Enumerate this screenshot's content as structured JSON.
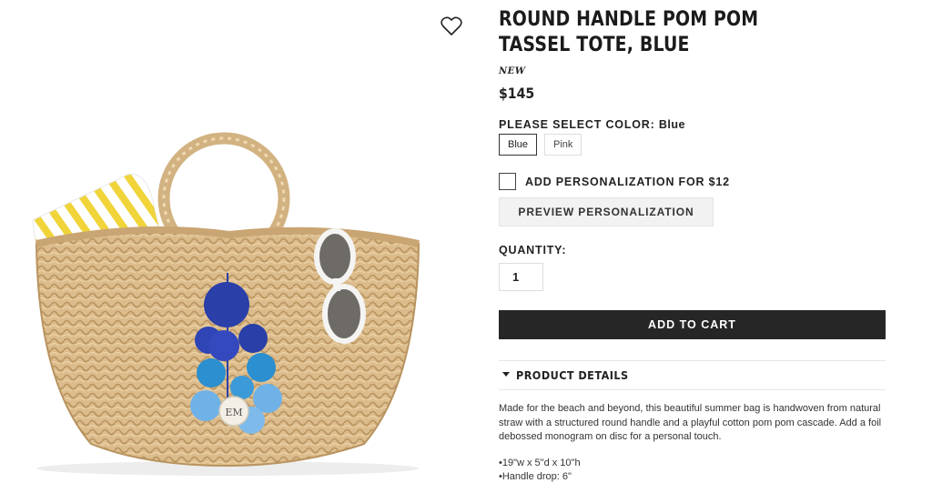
{
  "product": {
    "title": "ROUND HANDLE POM POM TASSEL TOTE, BLUE",
    "badge": "NEW",
    "price": "$145",
    "monogram": "EM"
  },
  "color": {
    "label": "PLEASE SELECT COLOR:",
    "selected": "Blue",
    "options": [
      "Blue",
      "Pink"
    ]
  },
  "personalization": {
    "checkbox_label": "ADD PERSONALIZATION FOR $12",
    "checked": false,
    "preview_label": "PREVIEW PERSONALIZATION"
  },
  "quantity": {
    "label": "QUANTITY:",
    "value": "1"
  },
  "cart": {
    "add_label": "ADD TO CART"
  },
  "details": {
    "heading": "PRODUCT DETAILS",
    "description": "Made for the beach and beyond, this beautiful summer bag is handwoven from natural straw with a structured round handle and a playful cotton pom pom cascade. Add a foil debossed monogram on disc for a personal touch.",
    "bullets": [
      "19\"w x 5\"d x 10\"h",
      "Handle drop: 6\""
    ]
  },
  "icons": {
    "wishlist": "heart-outline-icon",
    "details_toggle": "caret-down-icon"
  },
  "colors": {
    "button_dark": "#262626",
    "straw": "#d9b98a",
    "pom_navy": "#2a3fa8",
    "pom_blue": "#2b8fd0",
    "pom_light": "#6fb2e8"
  }
}
